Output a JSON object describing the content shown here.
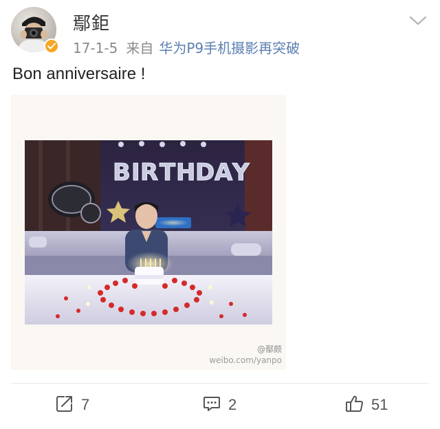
{
  "post": {
    "author": "鄢鉅",
    "date": "17-1-5",
    "from_label": "来自",
    "source": "华为P9手机摄影再突破",
    "text": "Bon anniversaire !"
  },
  "photo": {
    "banner_letters": "BIRTHDAY",
    "watermark_handle": "@鄢颇",
    "watermark_url": "weibo.com/yanpo"
  },
  "actions": {
    "repost_count": "7",
    "comment_count": "2",
    "like_count": "51"
  },
  "colors": {
    "source_link": "#5b7fb1",
    "verify_badge": "#f5a623",
    "meta_text": "#8a8a8a"
  },
  "icons": {
    "menu": "chevron-down-icon",
    "repost": "share-icon",
    "comment": "comment-icon",
    "like": "thumbs-up-icon",
    "verified": "verified-badge-icon"
  }
}
